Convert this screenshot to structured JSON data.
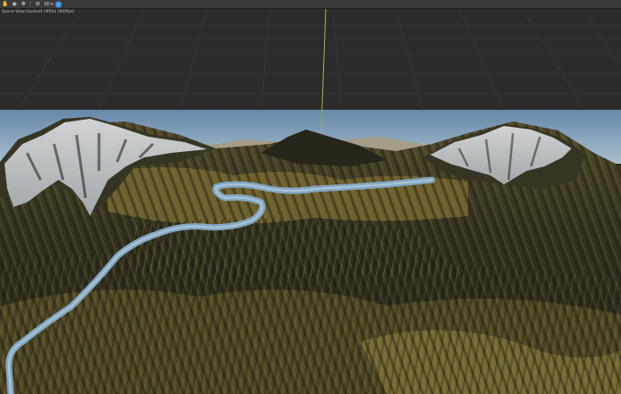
{
  "window": {
    "status_label": "Scene View [locked] (90%) (400fps)"
  },
  "toolbar": {
    "items": [
      {
        "name": "hand-tool-icon",
        "glyph": "✋"
      },
      {
        "name": "orbit-tool-icon",
        "glyph": "◉"
      },
      {
        "name": "move-tool-icon",
        "glyph": "✥"
      },
      {
        "name": "settings-icon",
        "glyph": "⚙"
      },
      {
        "name": "view-mode-dropdown",
        "label": "3D"
      }
    ]
  },
  "colors": {
    "grid_bg": "#2b2b2b",
    "grid_line": "#3a3a3a",
    "sky_top": "#6f93b8",
    "sky_bottom": "#a9c3d9",
    "axis_line": "#9bbf3c",
    "river": "#8fb7d6",
    "terrain_dark": "#2a2b1e",
    "terrain_mid": "#4f4a2e",
    "terrain_grass": "#8a7a3a",
    "snow": "#e8ecef"
  }
}
